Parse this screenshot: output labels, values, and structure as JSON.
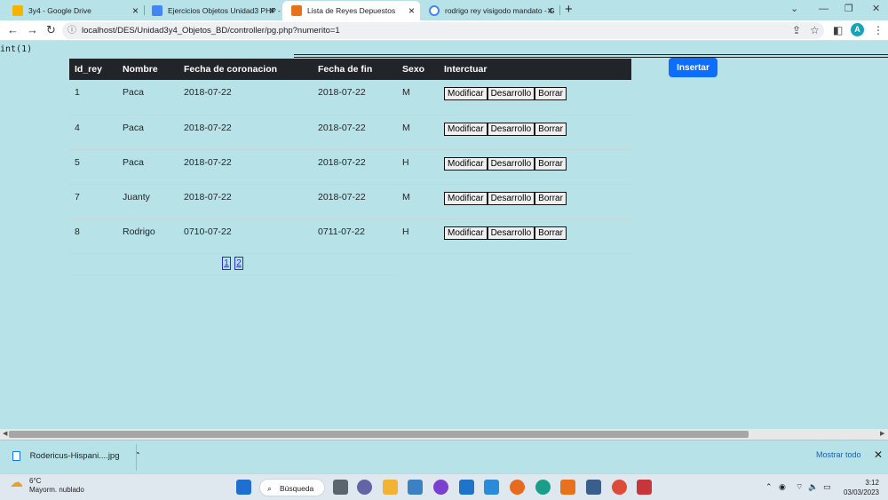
{
  "browser": {
    "tabs": [
      {
        "title": "3y4 - Google Drive",
        "active": false,
        "favicon_color": "#f4b400"
      },
      {
        "title": "Ejercicios Objetos Unidad3 PHP -",
        "active": false,
        "favicon_color": "#4285f4"
      },
      {
        "title": "Lista de Reyes Depuestos",
        "active": true,
        "favicon_color": "#e8711c"
      },
      {
        "title": "rodrigo rey visigodo mandato - G",
        "active": false,
        "favicon_color": "#4285f4"
      }
    ],
    "url": "localhost/DES/Unidad3y4_Objetos_BD/controller/pg.php?numerito=1",
    "profile_initial": "A"
  },
  "page": {
    "debug_output": "int(1)",
    "insert_button": "Insertar",
    "table": {
      "headers": [
        "Id_rey",
        "Nombre",
        "Fecha de coronacion",
        "Fecha de fin",
        "Sexo",
        "Interctuar"
      ],
      "rows": [
        {
          "id": "1",
          "nombre": "Paca",
          "coronacion": "2018-07-22",
          "fin": "2018-07-22",
          "sexo": "M"
        },
        {
          "id": "4",
          "nombre": "Paca",
          "coronacion": "2018-07-22",
          "fin": "2018-07-22",
          "sexo": "M"
        },
        {
          "id": "5",
          "nombre": "Paca",
          "coronacion": "2018-07-22",
          "fin": "2018-07-22",
          "sexo": "H"
        },
        {
          "id": "7",
          "nombre": "Juanty",
          "coronacion": "2018-07-22",
          "fin": "2018-07-22",
          "sexo": "M"
        },
        {
          "id": "8",
          "nombre": "Rodrigo",
          "coronacion": "0710-07-22",
          "fin": "0711-07-22",
          "sexo": "H"
        }
      ],
      "actions": {
        "modify": "Modificar",
        "develop": "Desarrollo",
        "delete": "Borrar"
      }
    },
    "pagination": [
      "1",
      "2"
    ]
  },
  "downloads": {
    "file": "Rodericus-Hispani....jpg",
    "show_all": "Mostrar todo"
  },
  "taskbar": {
    "temperature": "6°C",
    "weather": "Mayorm. nublado",
    "search": "Búsqueda",
    "time": "3:12",
    "date": "03/03/2023"
  }
}
